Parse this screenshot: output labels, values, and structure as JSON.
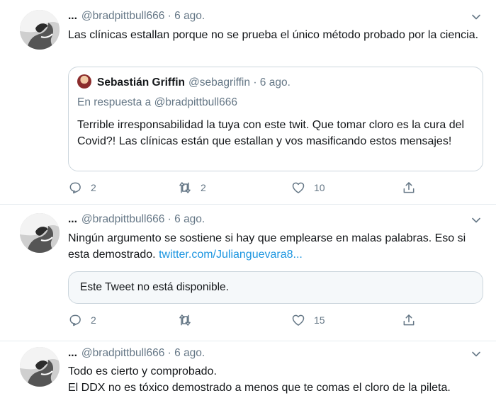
{
  "tweets": [
    {
      "display_name": "...",
      "handle": "@bradpittbull666",
      "date": "· 6 ago.",
      "text": "Las clínicas estallan porque no se prueba el único método probado por la ciencia.",
      "quote": {
        "display_name": "Sebastián Griffin",
        "handle": "@sebagriffin",
        "date": "· 6 ago.",
        "reply_to": "En respuesta a @bradpittbull666",
        "text": "Terrible irresponsabilidad la tuya con este twit. Que tomar cloro es la cura del Covid?! Las clínicas están que estallan y vos masificando estos mensajes!"
      },
      "replies": "2",
      "retweets": "2",
      "likes": "10"
    },
    {
      "display_name": "...",
      "handle": "@bradpittbull666",
      "date": "· 6 ago.",
      "text": "Ningún argumento se sostiene si hay que emplearse en malas palabras. Eso si esta demostrado.",
      "link": "twitter.com/Julianguevara8...",
      "unavailable": "Este Tweet no está disponible.",
      "replies": "2",
      "retweets": "",
      "likes": "15"
    },
    {
      "display_name": "...",
      "handle": "@bradpittbull666",
      "date": "· 6 ago.",
      "line1": "Todo es cierto y comprobado.",
      "line2": "El DDX no es tóxico demostrado a menos que te comas el cloro de la pileta."
    }
  ],
  "colors": {
    "link": "#1b95e0",
    "muted": "#657786",
    "border": "#e6ecf0"
  },
  "icons": [
    "reply-icon",
    "retweet-icon",
    "like-icon",
    "share-icon",
    "chevron-down-icon"
  ]
}
